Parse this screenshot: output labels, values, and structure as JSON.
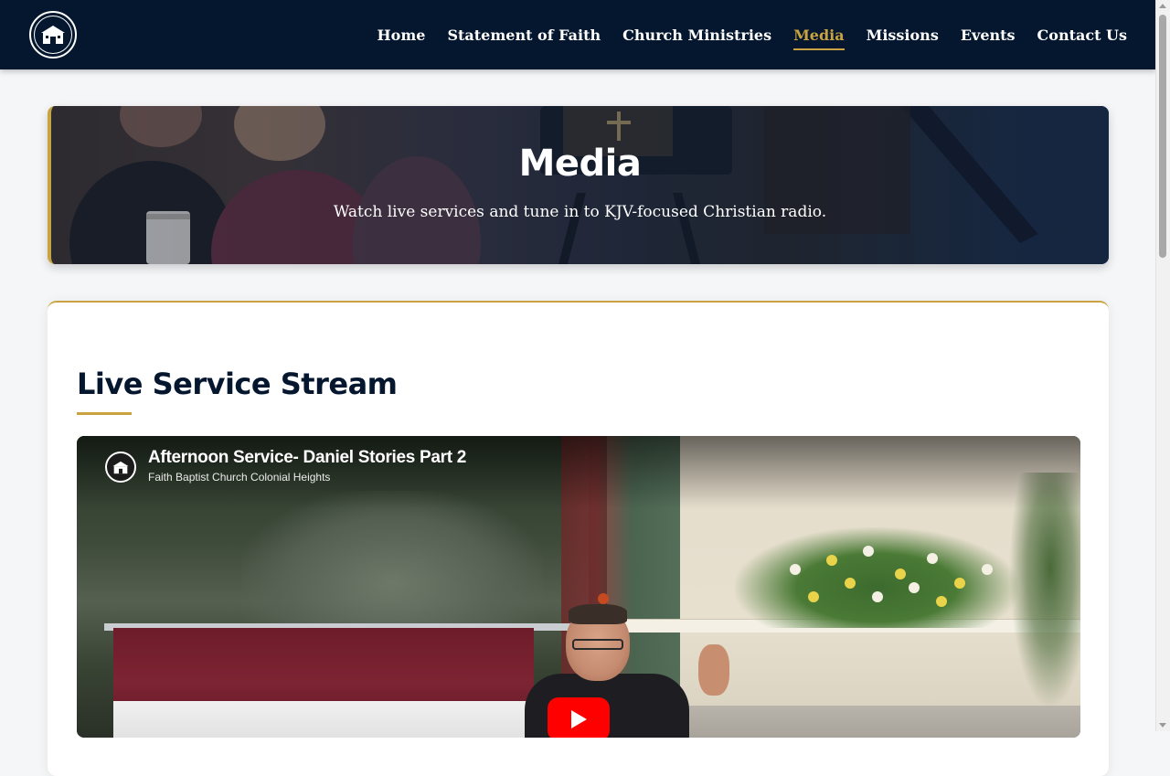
{
  "nav": {
    "logo_icon": "church-icon",
    "links": [
      {
        "label": "Home",
        "active": false
      },
      {
        "label": "Statement of Faith",
        "active": false
      },
      {
        "label": "Church Ministries",
        "active": false
      },
      {
        "label": "Media",
        "active": true
      },
      {
        "label": "Missions",
        "active": false
      },
      {
        "label": "Events",
        "active": false
      },
      {
        "label": "Contact Us",
        "active": false
      }
    ]
  },
  "hero": {
    "title": "Media",
    "subtitle": "Watch live services and tune in to KJV-focused Christian radio."
  },
  "section": {
    "title": "Live Service Stream"
  },
  "video": {
    "title": "Afternoon Service- Daniel Stories Part 2",
    "channel": "Faith Baptist Church Colonial Heights",
    "play_icon": "play-icon"
  },
  "colors": {
    "navy": "#04172f",
    "gold": "#c9a342",
    "youtube_red": "#ff0000"
  }
}
